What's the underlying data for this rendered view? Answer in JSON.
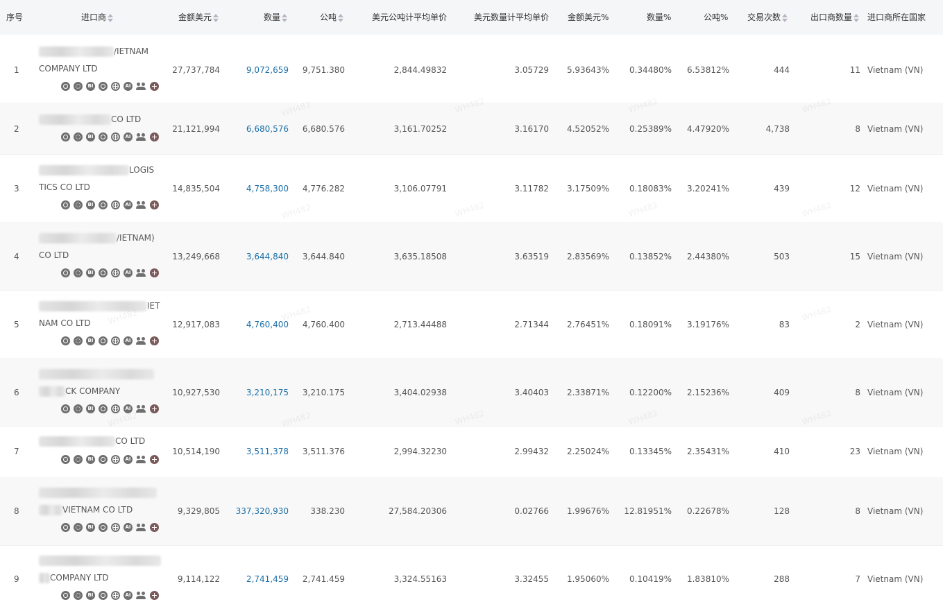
{
  "headers": {
    "index": "序号",
    "importer": "进口商",
    "amount_usd": "金额美元",
    "quantity": "数量",
    "tons": "公吨",
    "usd_per_ton": "美元公吨计平均单价",
    "usd_per_qty": "美元数量计平均单价",
    "amount_pct": "金额美元%",
    "qty_pct": "数量%",
    "ton_pct": "公吨%",
    "trades": "交易次数",
    "exporters": "出口商数量",
    "country": "进口商所在国家"
  },
  "watermark_text": "WH482",
  "icon_labels": {
    "bi": "BI",
    "ai": "AI"
  },
  "rows": [
    {
      "index": "1",
      "name1": "/IETNAM",
      "name2": "COMPANY LTD",
      "amount": "27,737,784",
      "qty": "9,072,659",
      "tons": "9,751.380",
      "usd_ton": "2,844.49832",
      "usd_qty": "3.05729",
      "amt_pct": "5.93643%",
      "qty_pct": "0.34480%",
      "ton_pct": "6.53812%",
      "trades": "444",
      "exporters": "11",
      "country": "Vietnam (VN)"
    },
    {
      "index": "2",
      "name1": "CO LTD",
      "name2": "",
      "amount": "21,121,994",
      "qty": "6,680,576",
      "tons": "6,680.576",
      "usd_ton": "3,161.70252",
      "usd_qty": "3.16170",
      "amt_pct": "4.52052%",
      "qty_pct": "0.25389%",
      "ton_pct": "4.47920%",
      "trades": "4,738",
      "exporters": "8",
      "country": "Vietnam (VN)"
    },
    {
      "index": "3",
      "name1": "LOGIS",
      "name2": "TICS CO LTD",
      "amount": "14,835,504",
      "qty": "4,758,300",
      "tons": "4,776.282",
      "usd_ton": "3,106.07791",
      "usd_qty": "3.11782",
      "amt_pct": "3.17509%",
      "qty_pct": "0.18083%",
      "ton_pct": "3.20241%",
      "trades": "439",
      "exporters": "12",
      "country": "Vietnam (VN)"
    },
    {
      "index": "4",
      "name1": "/IETNAM)",
      "name2": "CO LTD",
      "amount": "13,249,668",
      "qty": "3,644,840",
      "tons": "3,644.840",
      "usd_ton": "3,635.18508",
      "usd_qty": "3.63519",
      "amt_pct": "2.83569%",
      "qty_pct": "0.13852%",
      "ton_pct": "2.44380%",
      "trades": "503",
      "exporters": "15",
      "country": "Vietnam (VN)"
    },
    {
      "index": "5",
      "name1": "IET",
      "name2": "NAM CO LTD",
      "amount": "12,917,083",
      "qty": "4,760,400",
      "tons": "4,760.400",
      "usd_ton": "2,713.44488",
      "usd_qty": "2.71344",
      "amt_pct": "2.76451%",
      "qty_pct": "0.18091%",
      "ton_pct": "3.19176%",
      "trades": "83",
      "exporters": "2",
      "country": "Vietnam (VN)"
    },
    {
      "index": "6",
      "name1": "",
      "name2": "CK COMPANY",
      "amount": "10,927,530",
      "qty": "3,210,175",
      "tons": "3,210.175",
      "usd_ton": "3,404.02938",
      "usd_qty": "3.40403",
      "amt_pct": "2.33871%",
      "qty_pct": "0.12200%",
      "ton_pct": "2.15236%",
      "trades": "409",
      "exporters": "8",
      "country": "Vietnam (VN)"
    },
    {
      "index": "7",
      "name1": "CO LTD",
      "name2": "",
      "amount": "10,514,190",
      "qty": "3,511,378",
      "tons": "3,511.376",
      "usd_ton": "2,994.32230",
      "usd_qty": "2.99432",
      "amt_pct": "2.25024%",
      "qty_pct": "0.13345%",
      "ton_pct": "2.35431%",
      "trades": "410",
      "exporters": "23",
      "country": "Vietnam (VN)"
    },
    {
      "index": "8",
      "name1": "",
      "name2": "VIETNAM CO LTD",
      "amount": "9,329,805",
      "qty": "337,320,930",
      "tons": "338.230",
      "usd_ton": "27,584.20306",
      "usd_qty": "0.02766",
      "amt_pct": "1.99676%",
      "qty_pct": "12.81951%",
      "ton_pct": "0.22678%",
      "trades": "128",
      "exporters": "8",
      "country": "Vietnam (VN)"
    },
    {
      "index": "9",
      "name1": "",
      "name2": "COMPANY LTD",
      "amount": "9,114,122",
      "qty": "2,741,459",
      "tons": "2,741.459",
      "usd_ton": "3,324.55163",
      "usd_qty": "3.32455",
      "amt_pct": "1.95060%",
      "qty_pct": "0.10419%",
      "ton_pct": "1.83810%",
      "trades": "288",
      "exporters": "7",
      "country": "Vietnam (VN)"
    }
  ]
}
